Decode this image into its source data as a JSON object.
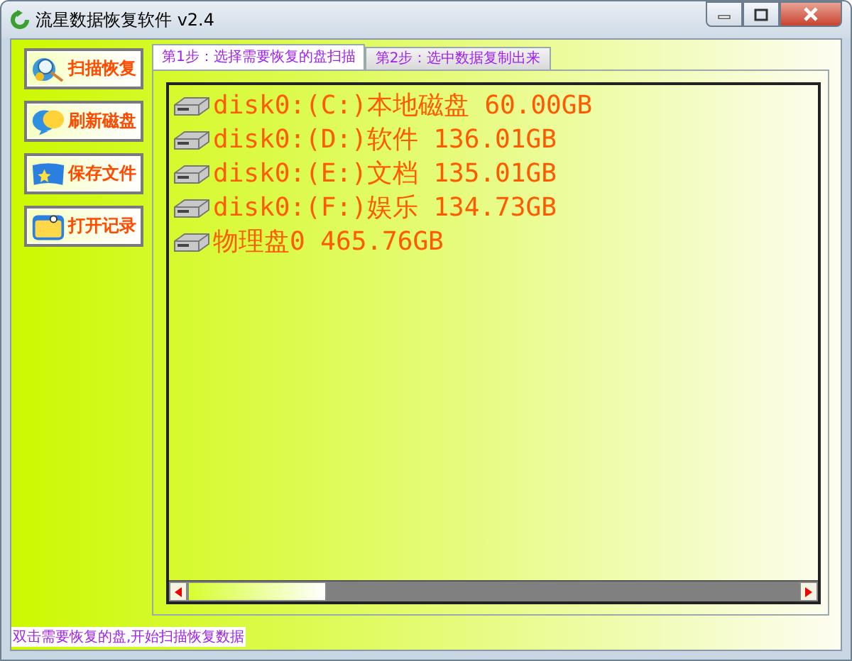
{
  "window": {
    "title": "流星数据恢复软件 v2.4"
  },
  "actions": [
    {
      "label": "扫描恢复",
      "kind": "scan"
    },
    {
      "label": "刷新磁盘",
      "kind": "refresh"
    },
    {
      "label": "保存文件",
      "kind": "save"
    },
    {
      "label": "打开记录",
      "kind": "open"
    }
  ],
  "tabs": [
    {
      "label": "第1步：选择需要恢复的盘扫描",
      "selected": true
    },
    {
      "label": "第2步：选中数据复制出来",
      "selected": false
    }
  ],
  "disks": [
    "disk0:(C:)本地磁盘 60.00GB",
    "disk0:(D:)软件 136.01GB",
    "disk0:(E:)文档 135.01GB",
    "disk0:(F:)娱乐 134.73GB",
    "物理盘0 465.76GB"
  ],
  "status_bar": "双击需要恢复的盘,开始扫描恢复数据"
}
